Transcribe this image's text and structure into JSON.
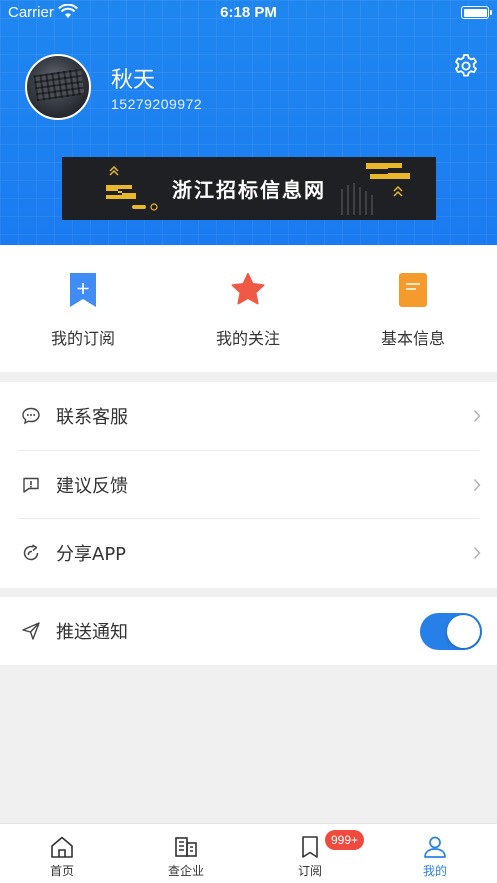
{
  "status_bar": {
    "carrier": "Carrier",
    "time": "6:18 PM"
  },
  "profile": {
    "name": "秋天",
    "phone": "15279209972"
  },
  "banner": {
    "text": "浙江招标信息网"
  },
  "quick_actions": [
    {
      "label": "我的订阅",
      "icon": "bookmark-plus-icon",
      "color": "#3f8cf5"
    },
    {
      "label": "我的关注",
      "icon": "star-icon",
      "color": "#ef5a47"
    },
    {
      "label": "基本信息",
      "icon": "document-icon",
      "color": "#f59a2c"
    }
  ],
  "menu": [
    {
      "label": "联系客服",
      "icon": "chat-icon"
    },
    {
      "label": "建议反馈",
      "icon": "feedback-icon"
    },
    {
      "label": "分享APP",
      "icon": "share-icon"
    }
  ],
  "push": {
    "label": "推送通知",
    "enabled": true
  },
  "tabs": [
    {
      "label": "首页",
      "icon": "home-icon"
    },
    {
      "label": "查企业",
      "icon": "company-icon"
    },
    {
      "label": "订阅",
      "icon": "bookmark-icon"
    },
    {
      "label": "我的",
      "icon": "user-icon",
      "active": true
    }
  ],
  "badge": "999+",
  "colors": {
    "primary": "#1f86f0",
    "accent_tab": "#2a83e8",
    "badge": "#f04a3e"
  }
}
